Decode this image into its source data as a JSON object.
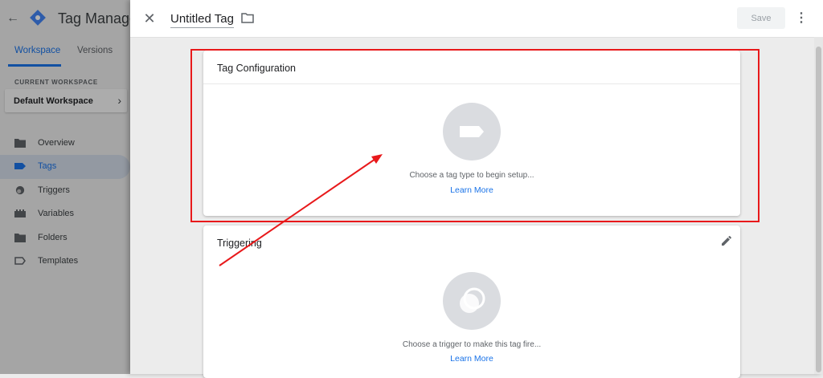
{
  "app": {
    "title": "Tag Manager",
    "tabs": [
      {
        "label": "Workspace",
        "active": true
      },
      {
        "label": "Versions",
        "active": false
      }
    ]
  },
  "workspace": {
    "section_label": "CURRENT WORKSPACE",
    "name": "Default Workspace"
  },
  "nav": {
    "items": [
      {
        "label": "Overview",
        "icon": "folder-icon",
        "active": false
      },
      {
        "label": "Tags",
        "icon": "tag-icon",
        "active": true
      },
      {
        "label": "Triggers",
        "icon": "trigger-icon",
        "active": false
      },
      {
        "label": "Variables",
        "icon": "variables-icon",
        "active": false
      },
      {
        "label": "Folders",
        "icon": "folder-icon",
        "active": false
      },
      {
        "label": "Templates",
        "icon": "template-icon",
        "active": false
      }
    ]
  },
  "editor": {
    "tag_name": "Untitled Tag",
    "save_label": "Save",
    "tag_config": {
      "title": "Tag Configuration",
      "hint": "Choose a tag type to begin setup...",
      "learn_more": "Learn More"
    },
    "triggering": {
      "title": "Triggering",
      "hint": "Choose a trigger to make this tag fire...",
      "learn_more": "Learn More"
    }
  },
  "colors": {
    "accent": "#1a73e8",
    "annotation": "#e8191b",
    "icon_circle": "#dadce0"
  }
}
